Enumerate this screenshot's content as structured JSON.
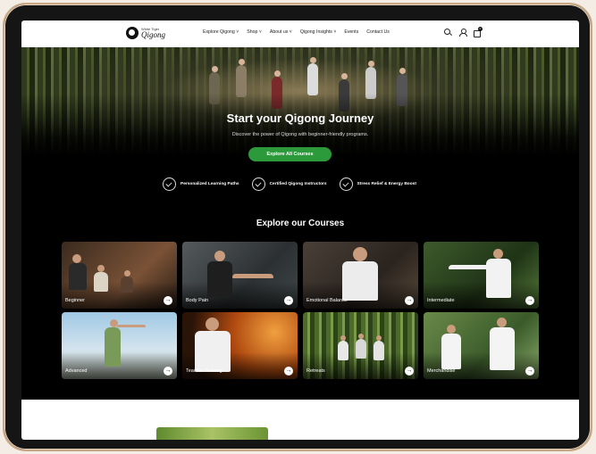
{
  "brand": {
    "line1": "White Tiger",
    "line2": "Qigong"
  },
  "nav": {
    "menu": [
      {
        "label": "Explore Qigong",
        "chevron": true
      },
      {
        "label": "Shop",
        "chevron": true
      },
      {
        "label": "About us",
        "chevron": true
      },
      {
        "label": "Qigong Insights",
        "chevron": true
      },
      {
        "label": "Events",
        "chevron": false
      },
      {
        "label": "Contact Us",
        "chevron": false
      }
    ],
    "cart_count": "0"
  },
  "hero": {
    "title": "Start your Qigong Journey",
    "subtitle": "Discover the power of Qigong with beginner-friendly programs.",
    "cta": "Explore All Courses"
  },
  "features": [
    "Personalized Learning Paths",
    "Certified Qigong Instructors",
    "Stress Relief & Energy Boost"
  ],
  "courses": {
    "title": "Explore our Courses",
    "items": [
      "Beginner",
      "Body Pain",
      "Emotional Balance",
      "Intermediate",
      "Advanced",
      "Teacher Training",
      "Retreats",
      "Merchandise"
    ]
  },
  "colors": {
    "accent": "#2c9a3a",
    "frame": "#c9a886"
  }
}
